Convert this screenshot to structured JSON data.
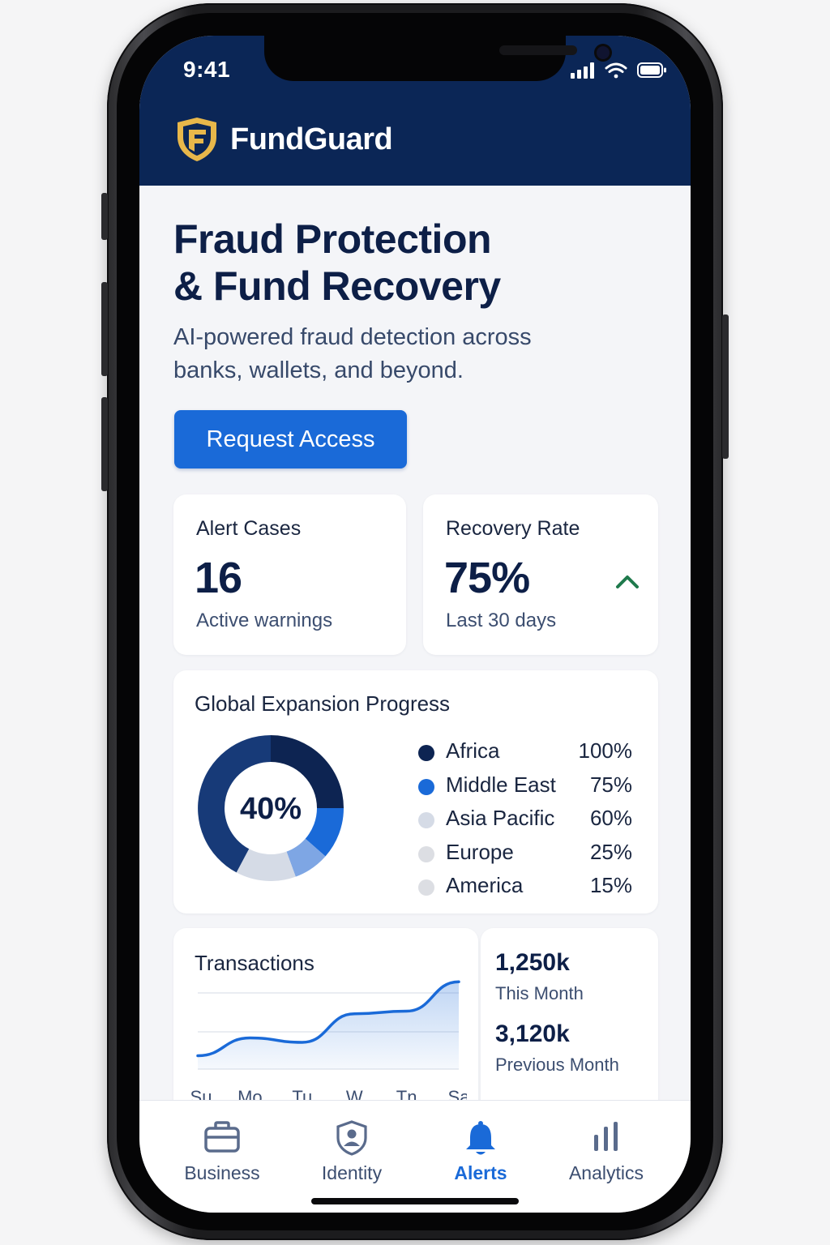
{
  "status_bar": {
    "time": "9:41"
  },
  "brand": {
    "name": "FundGuard",
    "logo_icon": "shield-f-logo"
  },
  "hero": {
    "title_line1": "Fraud Protection",
    "title_line2": "& Fund Recovery",
    "subtitle_line1": "AI-powered fraud detection across",
    "subtitle_line2": "banks, wallets, and beyond.",
    "cta_label": "Request Access"
  },
  "stats": {
    "alerts": {
      "label": "Alert Cases",
      "value": "16",
      "sub": "Active warnings"
    },
    "recovery": {
      "label": "Recovery Rate",
      "value": "75%",
      "sub": "Last 30 days",
      "trend_icon": "chevron-up-icon"
    }
  },
  "expansion": {
    "title": "Global Expansion Progress",
    "center_value": "40%",
    "regions": [
      {
        "name": "Africa",
        "value": "100%",
        "color": "#0d2452"
      },
      {
        "name": "Middle East",
        "value": "75%",
        "color": "#1a6ad8"
      },
      {
        "name": "Asia Pacific",
        "value": "60%",
        "color": "#d5dbe6"
      },
      {
        "name": "Europe",
        "value": "25%",
        "color": "#dcdee3"
      },
      {
        "name": "America",
        "value": "15%",
        "color": "#dcdee3"
      }
    ]
  },
  "transactions": {
    "title": "Transactions",
    "this_month_value": "1,250k",
    "this_month_label": "This Month",
    "prev_month_value": "3,120k",
    "prev_month_label": "Previous Month"
  },
  "chart_data": {
    "type": "area",
    "title": "Transactions",
    "categories": [
      "Su",
      "Mo",
      "Tu",
      "W",
      "Tn",
      "Sa"
    ],
    "series": [
      {
        "values": [
          0.15,
          0.35,
          0.3,
          0.62,
          0.65,
          0.98
        ]
      }
    ],
    "ylim": [
      0,
      1
    ],
    "grid": true,
    "color": "#1a6ad8"
  },
  "tabs": [
    {
      "label": "Business",
      "icon": "briefcase-icon"
    },
    {
      "label": "Identity",
      "icon": "shield-user-icon"
    },
    {
      "label": "Alerts",
      "icon": "bell-icon",
      "active": true
    },
    {
      "label": "Analytics",
      "icon": "bar-chart-icon"
    }
  ],
  "colors": {
    "brand_navy": "#0b2656",
    "accent_blue": "#1a6ad8",
    "gold": "#e8b74a",
    "trend_green": "#1f7a4c"
  }
}
